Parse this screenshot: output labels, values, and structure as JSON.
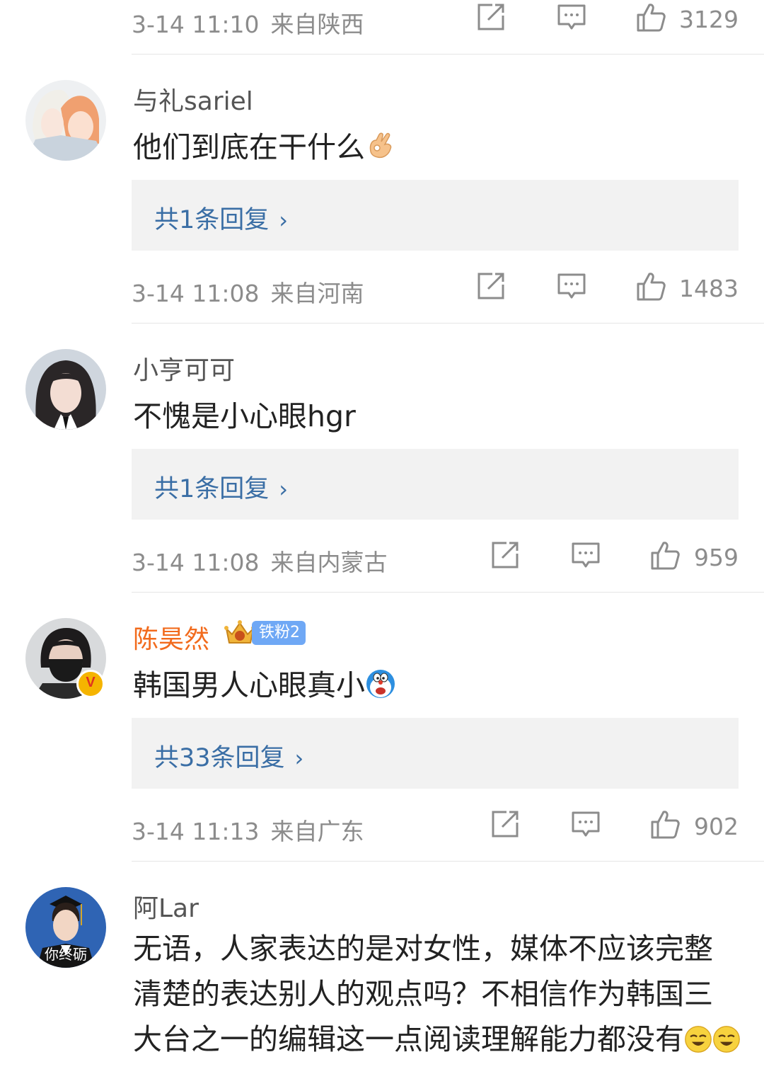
{
  "comments": [
    {
      "timestamp": "3-14 11:10",
      "location": "来自陕西",
      "likes": "3129"
    },
    {
      "username": "与礼sariel",
      "content": "他们到底在干什么",
      "reply_label": "共1条回复",
      "timestamp": "3-14 11:08",
      "location": "来自河南",
      "likes": "1483"
    },
    {
      "username": "小亨可可",
      "content": "不愧是小心眼hgr",
      "reply_label": "共1条回复",
      "timestamp": "3-14 11:08",
      "location": "来自内蒙古",
      "likes": "959"
    },
    {
      "username": "陈昊然",
      "fan_badge": "铁粉2",
      "content": "韩国男人心眼真小",
      "reply_label": "共33条回复",
      "timestamp": "3-14 11:13",
      "location": "来自广东",
      "likes": "902"
    },
    {
      "username": "阿Lar",
      "content": "无语，人家表达的是对女性，媒体不应该完整清楚的表达别人的观点吗？不相信作为韩国三大台之一的编辑这一点阅读理解能力都没有",
      "avatar_caption": "你终砺"
    }
  ],
  "icons": {
    "share": "share-icon",
    "comment": "comment-icon",
    "like": "thumbs-up-icon",
    "chevron": "chevron-right-icon"
  },
  "colors": {
    "username_vip": "#f26b1d",
    "reply_link": "#3a6ea5",
    "meta_gray": "#8c8c8c"
  }
}
